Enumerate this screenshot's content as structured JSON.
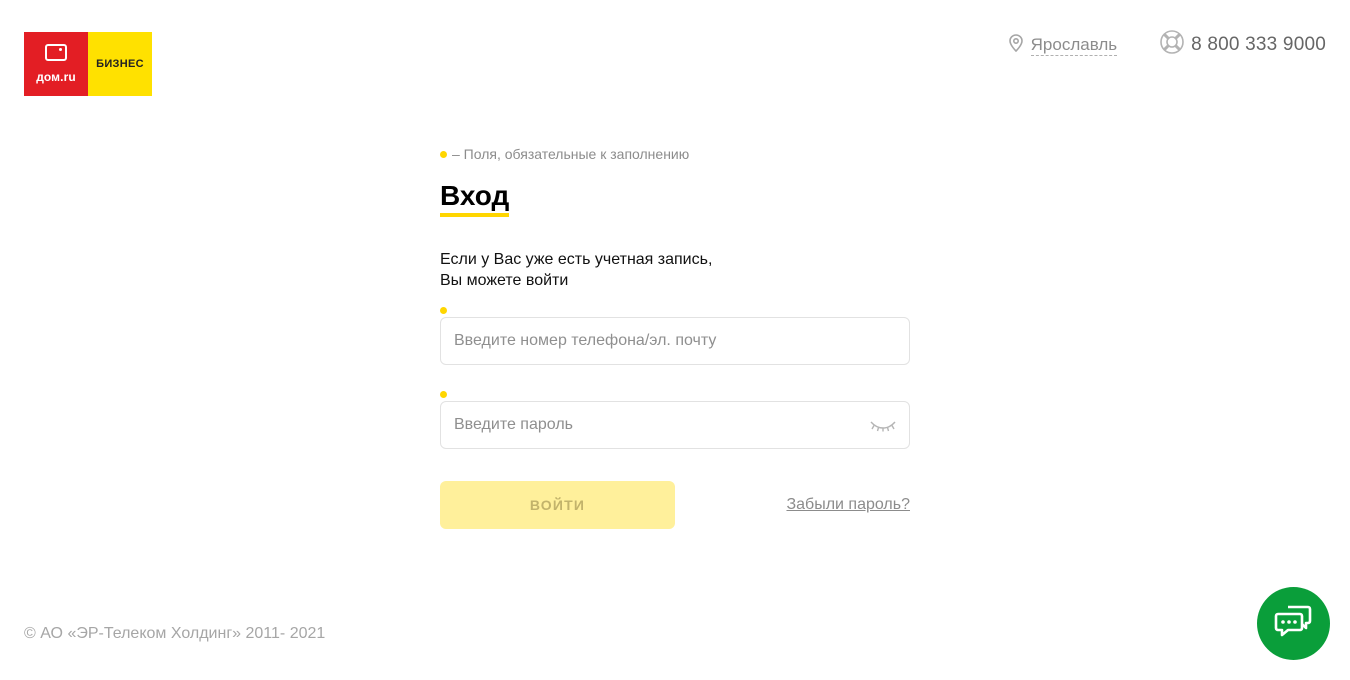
{
  "logo": {
    "brand": "дом.ru",
    "segment": "БИЗНЕС"
  },
  "header": {
    "city": "Ярославль",
    "support_phone": "8 800 333 9000"
  },
  "form": {
    "required_note": "– Поля, обязательные к заполнению",
    "title": "Вход",
    "intro_line1": "Если у Вас уже есть учетная запись,",
    "intro_line2": "Вы можете войти",
    "login_placeholder": "Введите номер телефона/эл. почту",
    "login_value": "",
    "password_placeholder": "Введите пароль",
    "password_value": "",
    "submit_label": "ВОЙТИ",
    "forgot_label": "Забыли пароль?"
  },
  "footer": {
    "copyright": "© АО «ЭР-Телеком Холдинг» 2011- 2021"
  },
  "icons": {
    "location": "location-pin-icon",
    "support": "lifebuoy-icon",
    "eye": "eye-closed-icon",
    "chat": "chat-icon"
  },
  "colors": {
    "brand_red": "#e31e24",
    "brand_yellow": "#ffe100",
    "accent_yellow": "#ffd600",
    "button_disabled": "#fff09b",
    "chat_green": "#0a9e3a"
  }
}
